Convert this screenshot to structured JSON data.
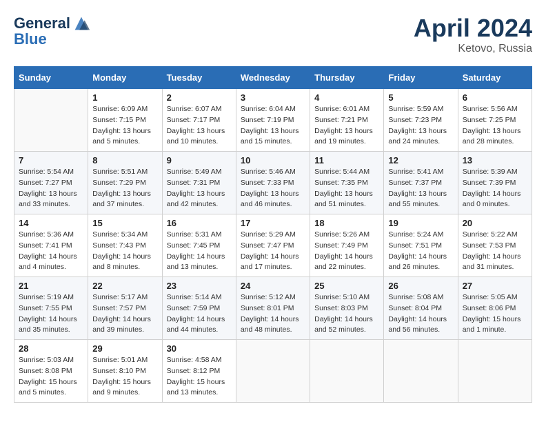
{
  "header": {
    "logo_line1": "General",
    "logo_line2": "Blue",
    "month_year": "April 2024",
    "location": "Ketovo, Russia"
  },
  "columns": [
    "Sunday",
    "Monday",
    "Tuesday",
    "Wednesday",
    "Thursday",
    "Friday",
    "Saturday"
  ],
  "weeks": [
    [
      {
        "day": "",
        "sunrise": "",
        "sunset": "",
        "daylight": ""
      },
      {
        "day": "1",
        "sunrise": "Sunrise: 6:09 AM",
        "sunset": "Sunset: 7:15 PM",
        "daylight": "Daylight: 13 hours and 5 minutes."
      },
      {
        "day": "2",
        "sunrise": "Sunrise: 6:07 AM",
        "sunset": "Sunset: 7:17 PM",
        "daylight": "Daylight: 13 hours and 10 minutes."
      },
      {
        "day": "3",
        "sunrise": "Sunrise: 6:04 AM",
        "sunset": "Sunset: 7:19 PM",
        "daylight": "Daylight: 13 hours and 15 minutes."
      },
      {
        "day": "4",
        "sunrise": "Sunrise: 6:01 AM",
        "sunset": "Sunset: 7:21 PM",
        "daylight": "Daylight: 13 hours and 19 minutes."
      },
      {
        "day": "5",
        "sunrise": "Sunrise: 5:59 AM",
        "sunset": "Sunset: 7:23 PM",
        "daylight": "Daylight: 13 hours and 24 minutes."
      },
      {
        "day": "6",
        "sunrise": "Sunrise: 5:56 AM",
        "sunset": "Sunset: 7:25 PM",
        "daylight": "Daylight: 13 hours and 28 minutes."
      }
    ],
    [
      {
        "day": "7",
        "sunrise": "Sunrise: 5:54 AM",
        "sunset": "Sunset: 7:27 PM",
        "daylight": "Daylight: 13 hours and 33 minutes."
      },
      {
        "day": "8",
        "sunrise": "Sunrise: 5:51 AM",
        "sunset": "Sunset: 7:29 PM",
        "daylight": "Daylight: 13 hours and 37 minutes."
      },
      {
        "day": "9",
        "sunrise": "Sunrise: 5:49 AM",
        "sunset": "Sunset: 7:31 PM",
        "daylight": "Daylight: 13 hours and 42 minutes."
      },
      {
        "day": "10",
        "sunrise": "Sunrise: 5:46 AM",
        "sunset": "Sunset: 7:33 PM",
        "daylight": "Daylight: 13 hours and 46 minutes."
      },
      {
        "day": "11",
        "sunrise": "Sunrise: 5:44 AM",
        "sunset": "Sunset: 7:35 PM",
        "daylight": "Daylight: 13 hours and 51 minutes."
      },
      {
        "day": "12",
        "sunrise": "Sunrise: 5:41 AM",
        "sunset": "Sunset: 7:37 PM",
        "daylight": "Daylight: 13 hours and 55 minutes."
      },
      {
        "day": "13",
        "sunrise": "Sunrise: 5:39 AM",
        "sunset": "Sunset: 7:39 PM",
        "daylight": "Daylight: 14 hours and 0 minutes."
      }
    ],
    [
      {
        "day": "14",
        "sunrise": "Sunrise: 5:36 AM",
        "sunset": "Sunset: 7:41 PM",
        "daylight": "Daylight: 14 hours and 4 minutes."
      },
      {
        "day": "15",
        "sunrise": "Sunrise: 5:34 AM",
        "sunset": "Sunset: 7:43 PM",
        "daylight": "Daylight: 14 hours and 8 minutes."
      },
      {
        "day": "16",
        "sunrise": "Sunrise: 5:31 AM",
        "sunset": "Sunset: 7:45 PM",
        "daylight": "Daylight: 14 hours and 13 minutes."
      },
      {
        "day": "17",
        "sunrise": "Sunrise: 5:29 AM",
        "sunset": "Sunset: 7:47 PM",
        "daylight": "Daylight: 14 hours and 17 minutes."
      },
      {
        "day": "18",
        "sunrise": "Sunrise: 5:26 AM",
        "sunset": "Sunset: 7:49 PM",
        "daylight": "Daylight: 14 hours and 22 minutes."
      },
      {
        "day": "19",
        "sunrise": "Sunrise: 5:24 AM",
        "sunset": "Sunset: 7:51 PM",
        "daylight": "Daylight: 14 hours and 26 minutes."
      },
      {
        "day": "20",
        "sunrise": "Sunrise: 5:22 AM",
        "sunset": "Sunset: 7:53 PM",
        "daylight": "Daylight: 14 hours and 31 minutes."
      }
    ],
    [
      {
        "day": "21",
        "sunrise": "Sunrise: 5:19 AM",
        "sunset": "Sunset: 7:55 PM",
        "daylight": "Daylight: 14 hours and 35 minutes."
      },
      {
        "day": "22",
        "sunrise": "Sunrise: 5:17 AM",
        "sunset": "Sunset: 7:57 PM",
        "daylight": "Daylight: 14 hours and 39 minutes."
      },
      {
        "day": "23",
        "sunrise": "Sunrise: 5:14 AM",
        "sunset": "Sunset: 7:59 PM",
        "daylight": "Daylight: 14 hours and 44 minutes."
      },
      {
        "day": "24",
        "sunrise": "Sunrise: 5:12 AM",
        "sunset": "Sunset: 8:01 PM",
        "daylight": "Daylight: 14 hours and 48 minutes."
      },
      {
        "day": "25",
        "sunrise": "Sunrise: 5:10 AM",
        "sunset": "Sunset: 8:03 PM",
        "daylight": "Daylight: 14 hours and 52 minutes."
      },
      {
        "day": "26",
        "sunrise": "Sunrise: 5:08 AM",
        "sunset": "Sunset: 8:04 PM",
        "daylight": "Daylight: 14 hours and 56 minutes."
      },
      {
        "day": "27",
        "sunrise": "Sunrise: 5:05 AM",
        "sunset": "Sunset: 8:06 PM",
        "daylight": "Daylight: 15 hours and 1 minute."
      }
    ],
    [
      {
        "day": "28",
        "sunrise": "Sunrise: 5:03 AM",
        "sunset": "Sunset: 8:08 PM",
        "daylight": "Daylight: 15 hours and 5 minutes."
      },
      {
        "day": "29",
        "sunrise": "Sunrise: 5:01 AM",
        "sunset": "Sunset: 8:10 PM",
        "daylight": "Daylight: 15 hours and 9 minutes."
      },
      {
        "day": "30",
        "sunrise": "Sunrise: 4:58 AM",
        "sunset": "Sunset: 8:12 PM",
        "daylight": "Daylight: 15 hours and 13 minutes."
      },
      {
        "day": "",
        "sunrise": "",
        "sunset": "",
        "daylight": ""
      },
      {
        "day": "",
        "sunrise": "",
        "sunset": "",
        "daylight": ""
      },
      {
        "day": "",
        "sunrise": "",
        "sunset": "",
        "daylight": ""
      },
      {
        "day": "",
        "sunrise": "",
        "sunset": "",
        "daylight": ""
      }
    ]
  ]
}
